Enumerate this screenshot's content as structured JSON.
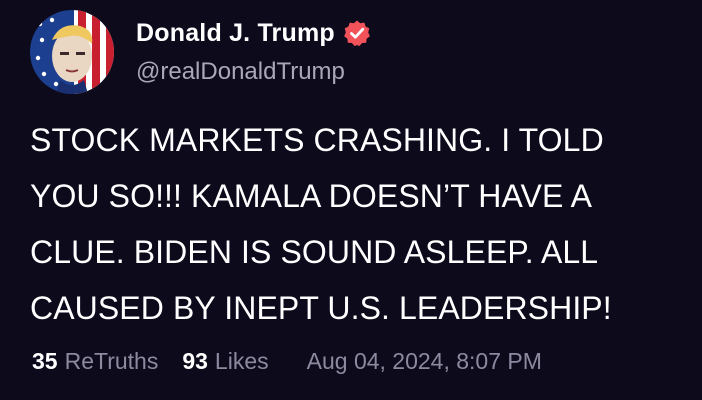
{
  "post": {
    "author": {
      "display_name": "Donald J. Trump",
      "handle": "@realDonaldTrump",
      "verified_icon": "verified-badge-icon",
      "verified_color": "#f2535b"
    },
    "text": "STOCK MARKETS CRASHING. I TOLD YOU SO!!! KAMALA DOESN’T HAVE A CLUE. BIDEN IS SOUND ASLEEP. ALL CAUSED BY INEPT U.S. LEADERSHIP!",
    "stats": {
      "retruths_count": "35",
      "retruths_label": "ReTruths",
      "likes_count": "93",
      "likes_label": "Likes"
    },
    "timestamp": "Aug 04, 2024, 8:07 PM"
  },
  "theme": {
    "background": "#0d0a1c",
    "text": "#ffffff",
    "muted": "#8d8aa0"
  }
}
